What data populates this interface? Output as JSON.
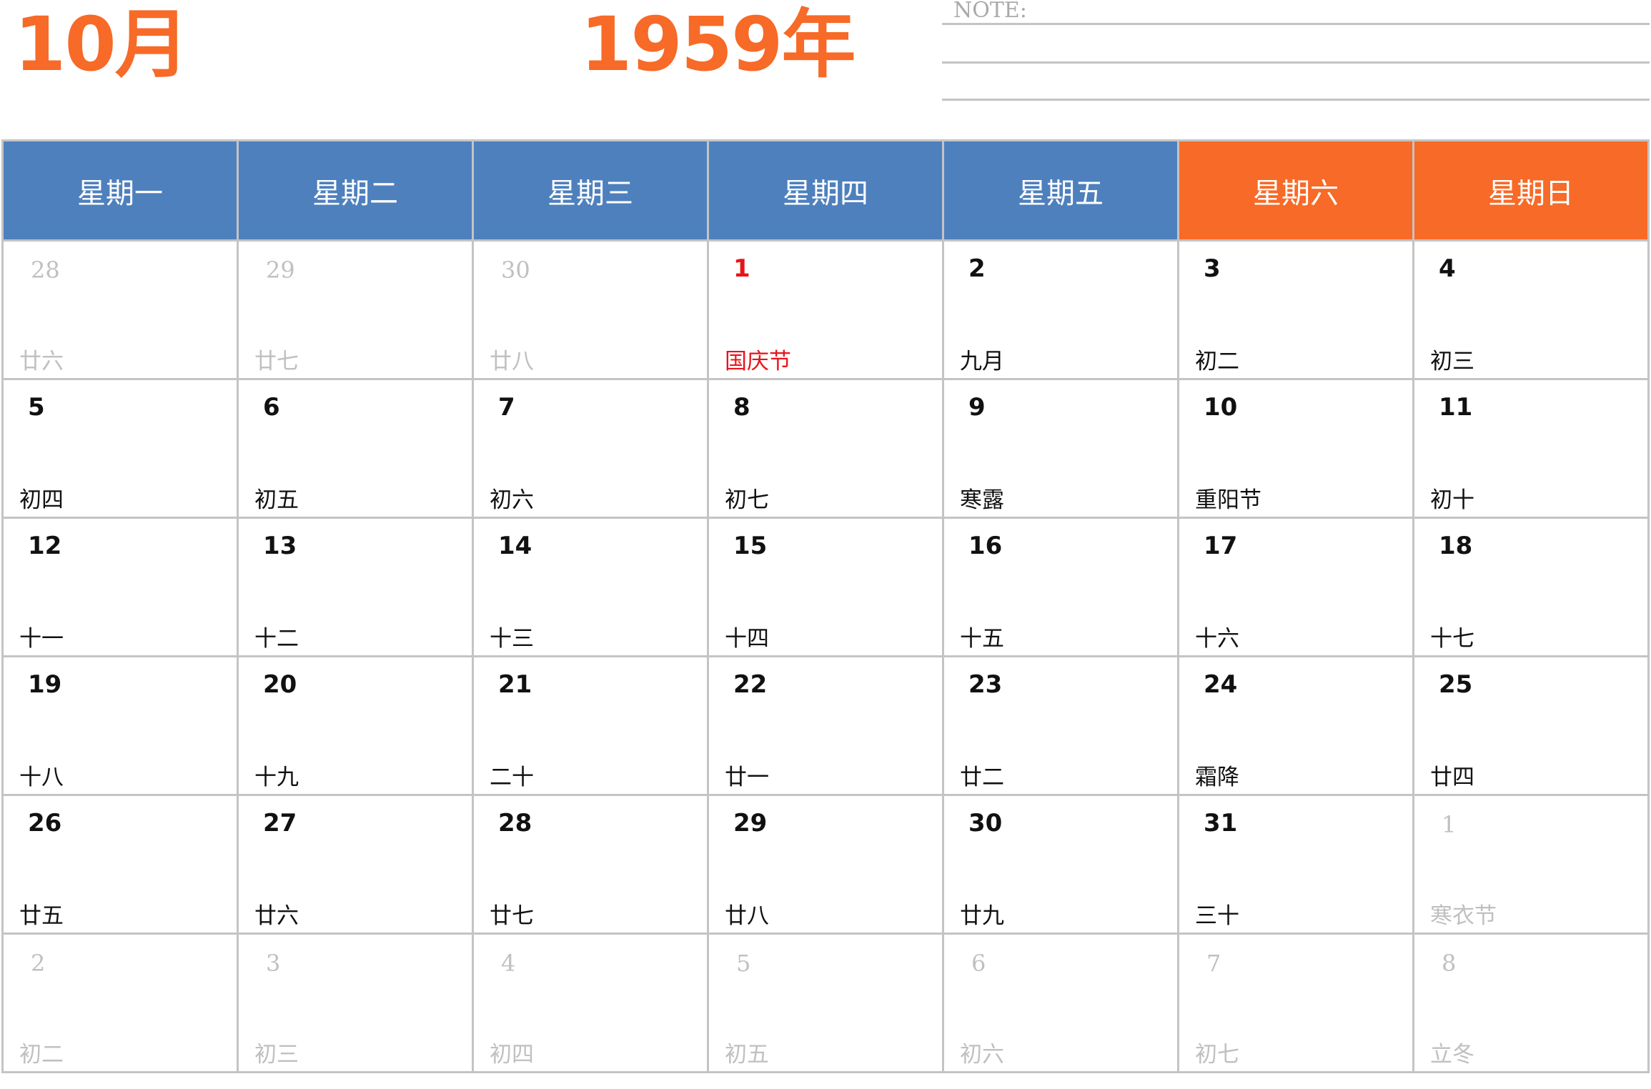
{
  "header": {
    "month": "10月",
    "year": "1959年",
    "note_label": "NOTE:"
  },
  "colors": {
    "accent": "#f76a27",
    "weekday_header": "#4e80bd",
    "weekend_header": "#f76a27",
    "grid": "#c4c4c4",
    "other_month_text": "#c0c0c0",
    "holiday_text": "#e8141b"
  },
  "weekdays": [
    {
      "label": "星期一",
      "weekend": false
    },
    {
      "label": "星期二",
      "weekend": false
    },
    {
      "label": "星期三",
      "weekend": false
    },
    {
      "label": "星期四",
      "weekend": false
    },
    {
      "label": "星期五",
      "weekend": false
    },
    {
      "label": "星期六",
      "weekend": true
    },
    {
      "label": "星期日",
      "weekend": true
    }
  ],
  "weeks": [
    [
      {
        "day": "28",
        "lunar": "廿六",
        "other": true
      },
      {
        "day": "29",
        "lunar": "廿七",
        "other": true
      },
      {
        "day": "30",
        "lunar": "廿八",
        "other": true
      },
      {
        "day": "1",
        "lunar": "国庆节",
        "holiday": true
      },
      {
        "day": "2",
        "lunar": "九月"
      },
      {
        "day": "3",
        "lunar": "初二"
      },
      {
        "day": "4",
        "lunar": "初三"
      }
    ],
    [
      {
        "day": "5",
        "lunar": "初四"
      },
      {
        "day": "6",
        "lunar": "初五"
      },
      {
        "day": "7",
        "lunar": "初六"
      },
      {
        "day": "8",
        "lunar": "初七"
      },
      {
        "day": "9",
        "lunar": "寒露"
      },
      {
        "day": "10",
        "lunar": "重阳节"
      },
      {
        "day": "11",
        "lunar": "初十"
      }
    ],
    [
      {
        "day": "12",
        "lunar": "十一"
      },
      {
        "day": "13",
        "lunar": "十二"
      },
      {
        "day": "14",
        "lunar": "十三"
      },
      {
        "day": "15",
        "lunar": "十四"
      },
      {
        "day": "16",
        "lunar": "十五"
      },
      {
        "day": "17",
        "lunar": "十六"
      },
      {
        "day": "18",
        "lunar": "十七"
      }
    ],
    [
      {
        "day": "19",
        "lunar": "十八"
      },
      {
        "day": "20",
        "lunar": "十九"
      },
      {
        "day": "21",
        "lunar": "二十"
      },
      {
        "day": "22",
        "lunar": "廿一"
      },
      {
        "day": "23",
        "lunar": "廿二"
      },
      {
        "day": "24",
        "lunar": "霜降"
      },
      {
        "day": "25",
        "lunar": "廿四"
      }
    ],
    [
      {
        "day": "26",
        "lunar": "廿五"
      },
      {
        "day": "27",
        "lunar": "廿六"
      },
      {
        "day": "28",
        "lunar": "廿七"
      },
      {
        "day": "29",
        "lunar": "廿八"
      },
      {
        "day": "30",
        "lunar": "廿九"
      },
      {
        "day": "31",
        "lunar": "三十"
      },
      {
        "day": "1",
        "lunar": "寒衣节",
        "other": true
      }
    ],
    [
      {
        "day": "2",
        "lunar": "初二",
        "other": true
      },
      {
        "day": "3",
        "lunar": "初三",
        "other": true
      },
      {
        "day": "4",
        "lunar": "初四",
        "other": true
      },
      {
        "day": "5",
        "lunar": "初五",
        "other": true
      },
      {
        "day": "6",
        "lunar": "初六",
        "other": true
      },
      {
        "day": "7",
        "lunar": "初七",
        "other": true
      },
      {
        "day": "8",
        "lunar": "立冬",
        "other": true
      }
    ]
  ]
}
